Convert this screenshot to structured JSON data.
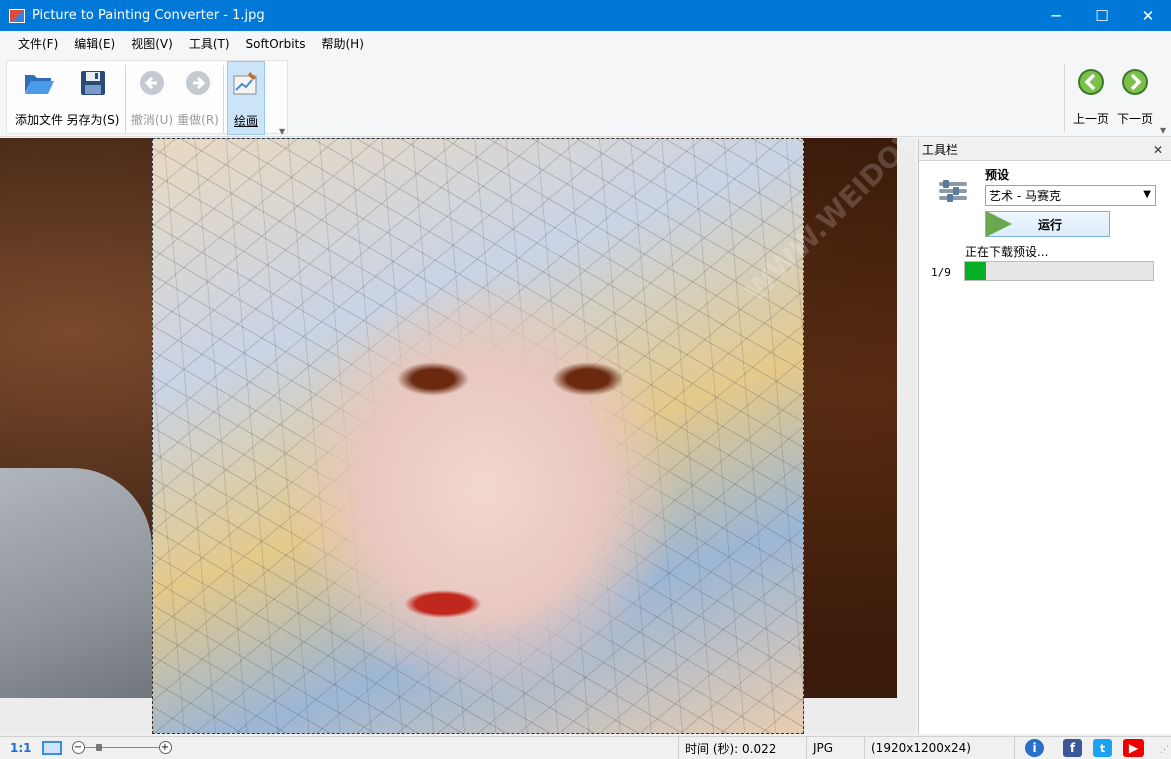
{
  "window": {
    "title": "Picture to Painting Converter - 1.jpg",
    "minimize_glyph": "─",
    "maximize_glyph": "☐",
    "close_glyph": "✕"
  },
  "menu": [
    "文件(F)",
    "编辑(E)",
    "视图(V)",
    "工具(T)",
    "SoftOrbits",
    "帮助(H)"
  ],
  "toolbar": {
    "add_file": "添加文件",
    "save_as": "另存为(S)",
    "undo": "撤消(U)",
    "redo": "重做(R)",
    "paint": "绘画",
    "prev_page": "上一页",
    "next_page": "下一页"
  },
  "panel": {
    "title": "工具栏",
    "preset_label": "预设",
    "preset_value": "艺术 - 马赛克",
    "run_label": "运行",
    "status": "正在下载预设...",
    "counter": "1/9",
    "progress_fraction": 0.11
  },
  "statusbar": {
    "zoom": "1:1",
    "zoom_minus": "−",
    "zoom_plus": "+",
    "time": "时间 (秒): 0.022",
    "format": "JPG",
    "dimensions": "(1920x1200x24)"
  },
  "watermark": "WWW.WEIDOWN.COM",
  "colors": {
    "titlebar": "#0078d7",
    "progress": "#06b025",
    "accent": "#1a6fd0"
  }
}
